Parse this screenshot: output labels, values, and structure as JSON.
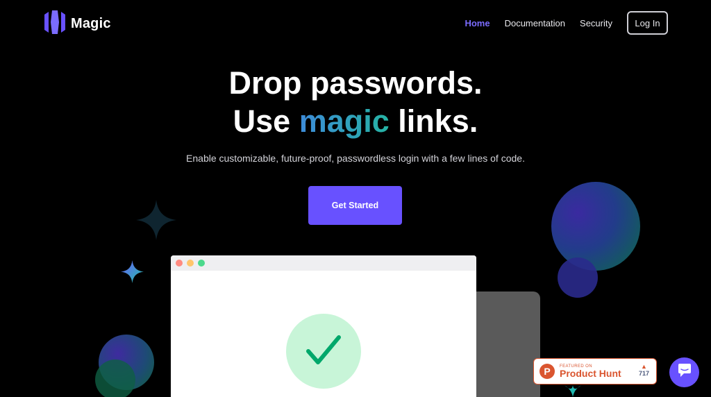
{
  "brand": {
    "name": "Magic",
    "accent": "#6851ff"
  },
  "nav": {
    "items": [
      {
        "label": "Home",
        "active": true
      },
      {
        "label": "Documentation",
        "active": false
      },
      {
        "label": "Security",
        "active": false
      }
    ],
    "login_label": "Log In"
  },
  "hero": {
    "line1": "Drop passwords.",
    "line2_prefix": "Use ",
    "line2_highlight": "magic",
    "line2_suffix": " links.",
    "subtitle": "Enable customizable, future-proof, passwordless login with a few lines of code.",
    "cta_label": "Get Started"
  },
  "product_hunt": {
    "small": "FEATURED ON",
    "big": "Product Hunt",
    "letter": "P",
    "votes": "717"
  },
  "colors": {
    "background": "#000000",
    "ph_orange": "#da552f",
    "check_green": "#00a86b",
    "check_bg": "#c8f5d8"
  }
}
